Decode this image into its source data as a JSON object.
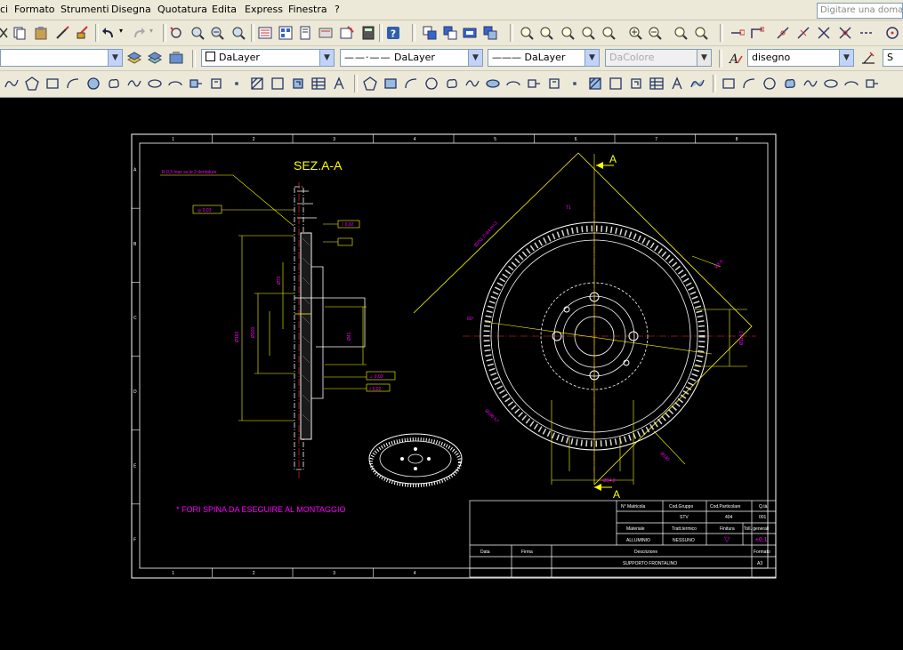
{
  "menu": {
    "items": [
      "ci",
      "Formato",
      "Strumenti",
      "Disegna",
      "Quotatura",
      "Edita",
      "Express",
      "Finestra",
      "?"
    ],
    "help_placeholder": "Digitare una domanda"
  },
  "properties": {
    "color_label": "DaLayer",
    "linetype_label": "DaLayer",
    "lineweight_label": "DaLayer",
    "plotstyle_label": "DaColore",
    "text_style": "disegno",
    "dim_style_partial": "S"
  },
  "drawing": {
    "section_title": "SEZ.A-A",
    "section_marker": "A",
    "note": "* FORI SPINA DA ESEGUIRE AL MONTAGGIO",
    "leader_note": "R 0,3 max su le 2 dentature",
    "top_ruler": [
      "1",
      "2",
      "3",
      "4",
      "5",
      "6",
      "7",
      "8"
    ],
    "bottom_ruler": [
      "1",
      "2",
      "3",
      "4"
    ],
    "side_ruler": [
      "A",
      "B",
      "C",
      "D",
      "E",
      "F"
    ],
    "title_block": {
      "h_matricola": "N° Matricola",
      "h_cod_gruppo": "Cod.Gruppo",
      "h_cod_particolare": "Cod.Particolare",
      "h_qta": "Q.tà",
      "v_cod_gruppo": "STV",
      "v_cod_particolare": "404",
      "v_qta": "001",
      "h_materiale": "Materiale",
      "h_tratt_termico": "Tratt.termico",
      "h_finitura": "Finitura",
      "h_toll": "Toll. generali",
      "v_materiale": "ALLUMINIO",
      "v_tratt_termico": "NESSUNO",
      "v_finitura": "▽",
      "v_toll": "±0,1",
      "h_data": "Data",
      "h_firma": "Firma",
      "h_descrizione": "Descrizione",
      "h_formato": "Formato",
      "v_descrizione": "SUPPORTO FRONTALINO",
      "v_formato": "A3"
    }
  },
  "colors": {
    "workspace": "#000000",
    "border": "#ffffff",
    "geometry": "#ffffff",
    "dimensions": "#ffff00",
    "annotation": "#ff00ff",
    "ui_bg": "#ece9d8"
  }
}
